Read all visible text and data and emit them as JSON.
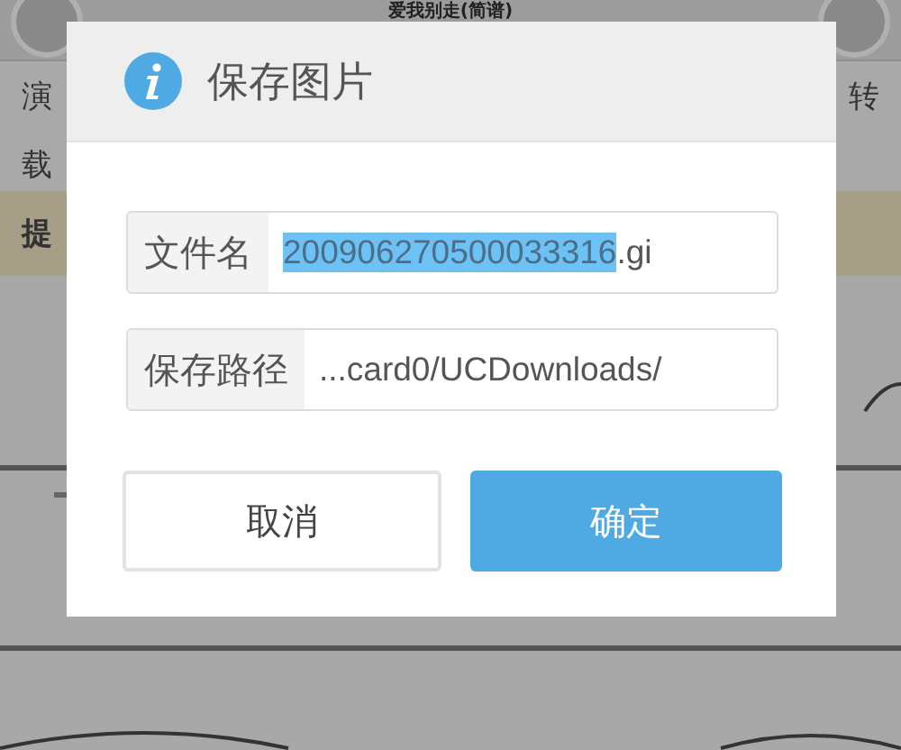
{
  "page": {
    "title": "爱我别走(简谱)",
    "singer_label": "演",
    "repost_label": "转",
    "repost_label_2": "载",
    "tip_label": "提"
  },
  "dialog": {
    "title": "保存图片",
    "fields": [
      {
        "label": "文件名",
        "value_selected": "200906270500033316",
        "value_rest": ".gi"
      },
      {
        "label": "保存路径",
        "value_rest": "...card0/UCDownloads/"
      }
    ],
    "buttons": [
      {
        "label": "取消",
        "kind": "secondary"
      },
      {
        "label": "确定",
        "kind": "primary"
      }
    ]
  }
}
